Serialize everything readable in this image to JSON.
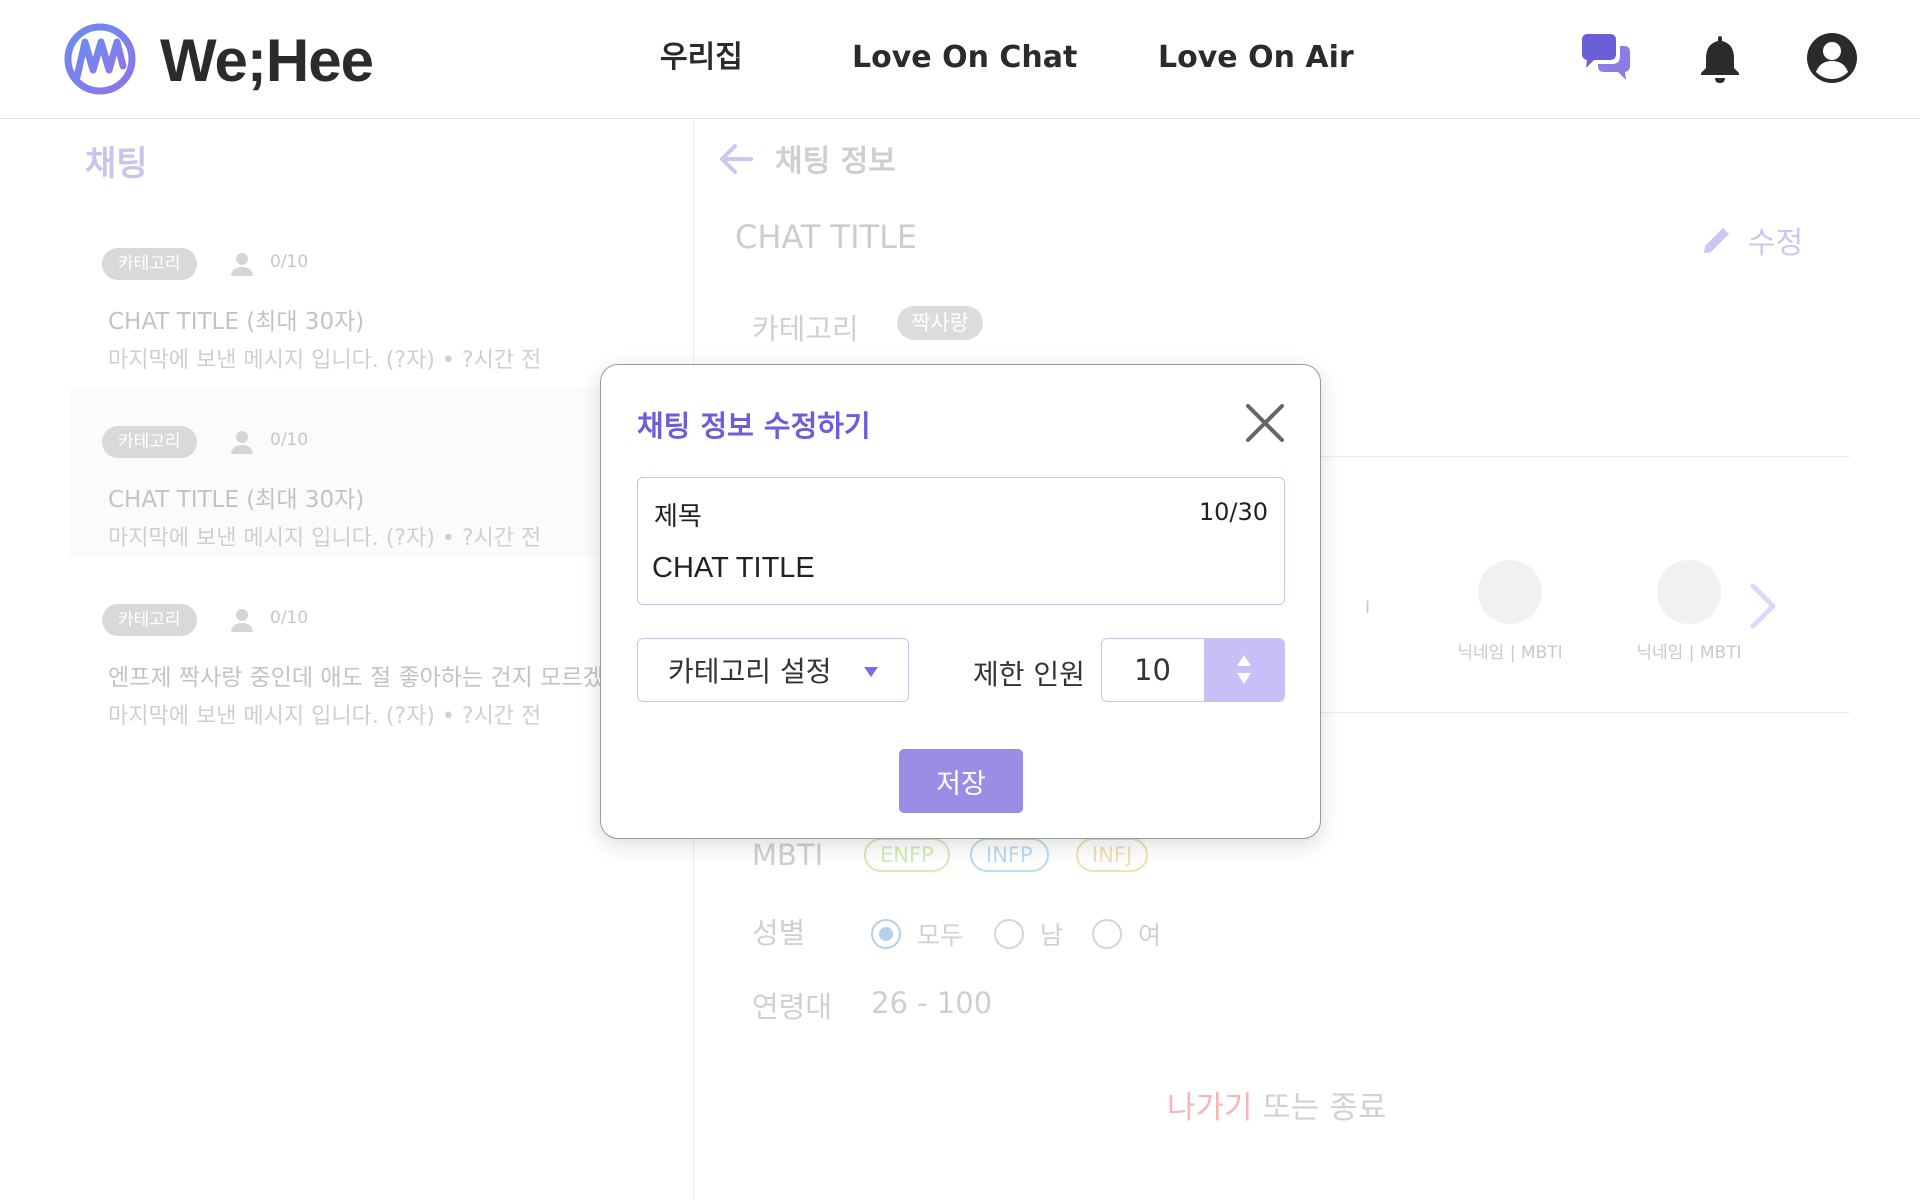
{
  "header": {
    "logo_text": "We;Hee",
    "nav": [
      "우리집",
      "Love On Chat",
      "Love On Air"
    ],
    "icons": [
      "chat-bubbles-icon",
      "bell-icon",
      "user-circle-icon"
    ],
    "accent": "#7a6de2"
  },
  "left": {
    "title": "채팅",
    "items": [
      {
        "badge": "카테고리",
        "count": "0/10",
        "title": "CHAT TITLE  (최대 30자)",
        "message": "마지막에 보낸 메시지 입니다. (?자)   •   ?시간 전"
      },
      {
        "badge": "카테고리",
        "count": "0/10",
        "title": "CHAT TITLE  (최대 30자)",
        "message": "마지막에 보낸 메시지 입니다. (?자)   •   ?시간 전"
      },
      {
        "badge": "카테고리",
        "count": "0/10",
        "title": "엔프제 짝사랑 중인데 애도 절 좋아하는 건지 모르겠어",
        "message": "마지막에 보낸 메시지 입니다. (?자)   •   ?시간 전"
      }
    ]
  },
  "right": {
    "header": "채팅 정보",
    "chat_title": "CHAT TITLE",
    "edit_label": "수정",
    "category_label": "카테고리",
    "category_value": "짝사랑",
    "members": [
      {
        "name": "닉네임 | MBTI"
      },
      {
        "name": "닉네임 | MBTI"
      }
    ],
    "partial_member_text": "I",
    "mbti_label": "MBTI",
    "mbti_tags": [
      {
        "label": "ENFP",
        "color": "#d4ecb4"
      },
      {
        "label": "INFP",
        "color": "#b9dcf3"
      },
      {
        "label": "INFJ",
        "color": "#f3dfb0"
      }
    ],
    "gender_label": "성별",
    "gender_options": [
      "모두",
      "남",
      "여"
    ],
    "gender_selected": "모두",
    "age_label": "연령대",
    "age_value": "26 - 100",
    "leave_a": "나가기",
    "leave_b": " 또는 종료"
  },
  "modal": {
    "title": "채팅 정보 수정하기",
    "field_label": "제목",
    "field_count": "10/30",
    "field_value": "CHAT TITLE",
    "category_select": "카테고리 설정",
    "limit_label": "제한 인원",
    "limit_value": "10",
    "save_label": "저장"
  }
}
